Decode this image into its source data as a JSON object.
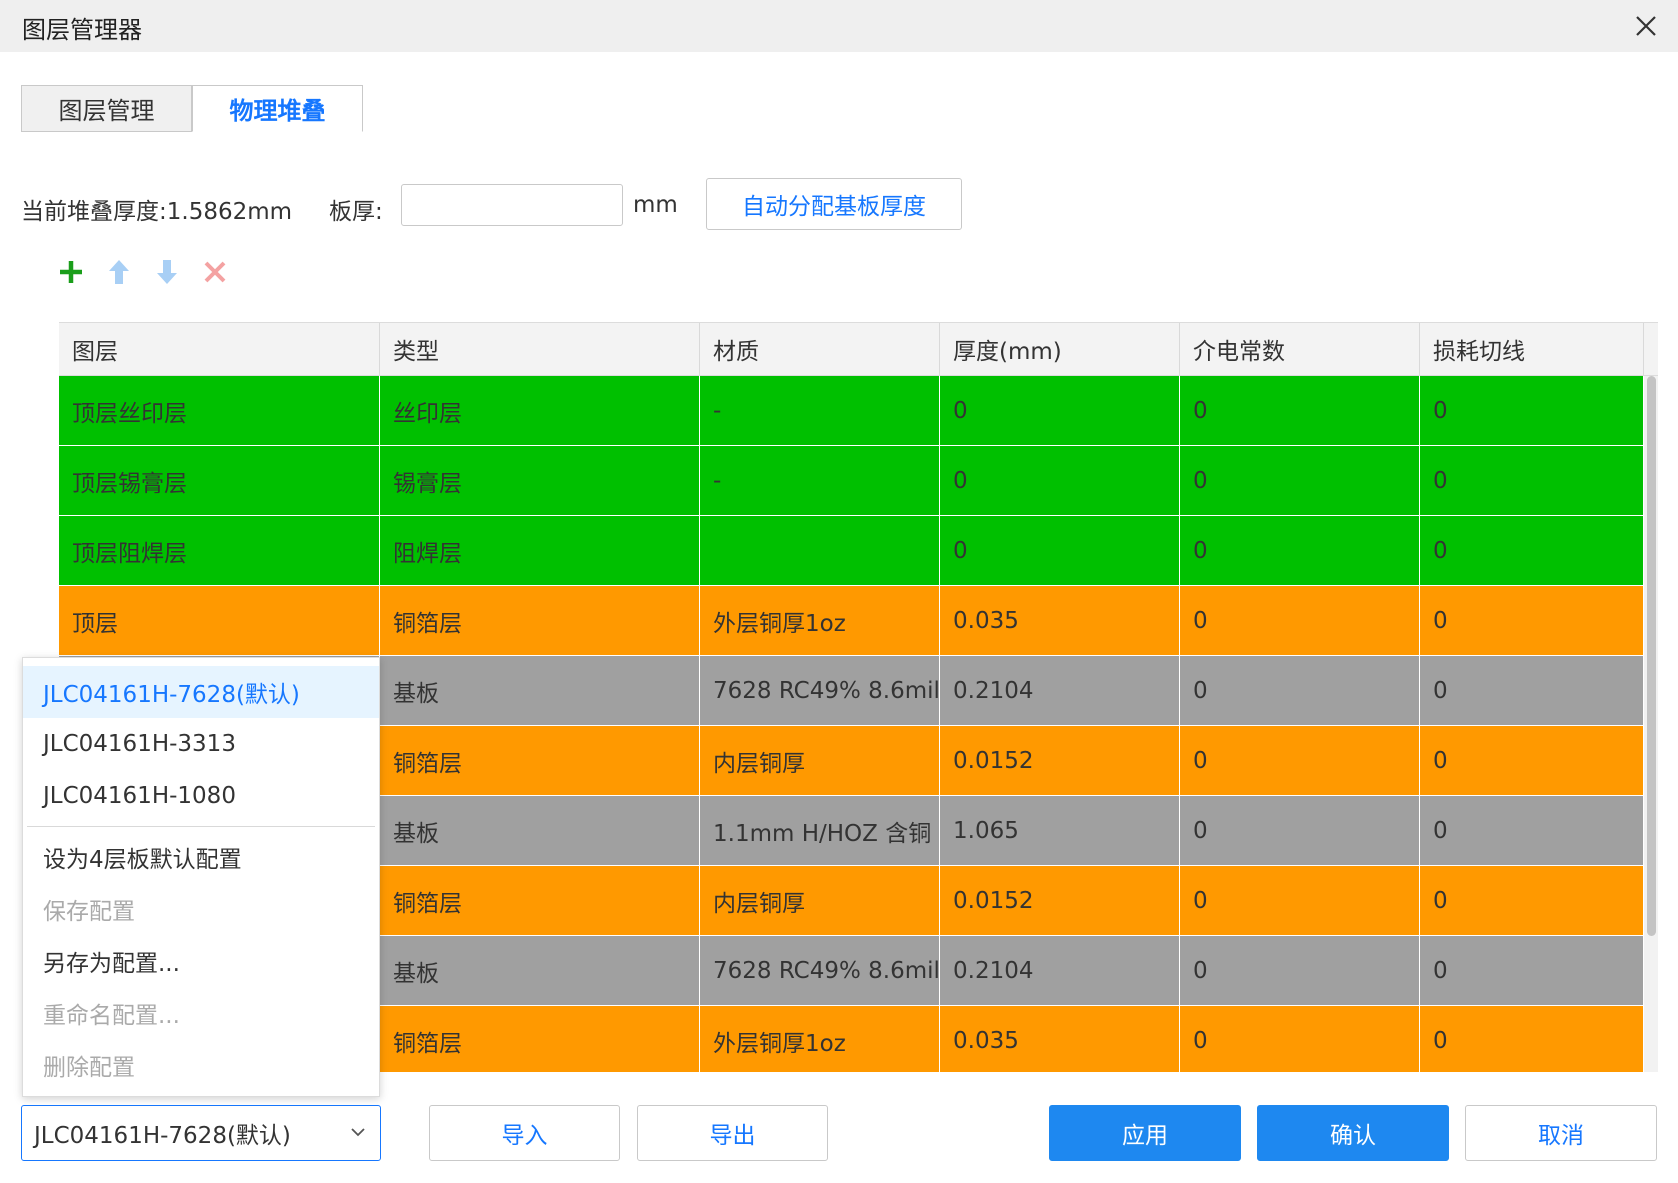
{
  "window": {
    "title": "图层管理器",
    "close_icon": "close-icon"
  },
  "tabs": [
    {
      "label": "图层管理",
      "active": false
    },
    {
      "label": "物理堆叠",
      "active": true
    }
  ],
  "stack_info": {
    "current_thickness_label": "当前堆叠厚度:1.5862mm",
    "board_thickness_label": "板厚:",
    "board_thickness_value": "",
    "unit": "mm",
    "auto_assign_button": "自动分配基板厚度"
  },
  "toolbar": {
    "add_icon": "plus-icon",
    "up_icon": "arrow-up-icon",
    "down_icon": "arrow-down-icon",
    "delete_icon": "delete-x-icon",
    "colors": {
      "add": "#1a9e1a",
      "up": "#a8cff5",
      "down": "#a8cff5",
      "delete": "#f4a2a2"
    }
  },
  "table": {
    "headers": [
      "图层",
      "类型",
      "材质",
      "厚度(mm)",
      "介电常数",
      "损耗切线"
    ],
    "colors": {
      "green": "#00c000",
      "orange": "#ff9900",
      "gray": "#a0a0a0"
    },
    "rows": [
      {
        "layer": "顶层丝印层",
        "type": "丝印层",
        "material": "-",
        "thickness": "0",
        "dk": "0",
        "df": "0",
        "color": "green"
      },
      {
        "layer": "顶层锡膏层",
        "type": "锡膏层",
        "material": "-",
        "thickness": "0",
        "dk": "0",
        "df": "0",
        "color": "green"
      },
      {
        "layer": "顶层阻焊层",
        "type": "阻焊层",
        "material": "",
        "thickness": "0",
        "dk": "0",
        "df": "0",
        "color": "green"
      },
      {
        "layer": "顶层",
        "type": "铜箔层",
        "material": "外层铜厚1oz",
        "thickness": "0.035",
        "dk": "0",
        "df": "0",
        "color": "orange"
      },
      {
        "layer": "",
        "type": "基板",
        "material": "7628 RC49% 8.6mil",
        "thickness": "0.2104",
        "dk": "0",
        "df": "0",
        "color": "gray"
      },
      {
        "layer": "",
        "type": "铜箔层",
        "material": "内层铜厚",
        "thickness": "0.0152",
        "dk": "0",
        "df": "0",
        "color": "orange"
      },
      {
        "layer": "",
        "type": "基板",
        "material": "1.1mm H/HOZ 含铜",
        "thickness": "1.065",
        "dk": "0",
        "df": "0",
        "color": "gray"
      },
      {
        "layer": "",
        "type": "铜箔层",
        "material": "内层铜厚",
        "thickness": "0.0152",
        "dk": "0",
        "df": "0",
        "color": "orange"
      },
      {
        "layer": "",
        "type": "基板",
        "material": "7628 RC49% 8.6mil",
        "thickness": "0.2104",
        "dk": "0",
        "df": "0",
        "color": "gray"
      },
      {
        "layer": "",
        "type": "铜箔层",
        "material": "外层铜厚1oz",
        "thickness": "0.035",
        "dk": "0",
        "df": "0",
        "color": "orange"
      }
    ]
  },
  "config_menu": {
    "items": [
      {
        "label": "JLC04161H-7628(默认)",
        "state": "selected"
      },
      {
        "label": "JLC04161H-3313",
        "state": "normal"
      },
      {
        "label": "JLC04161H-1080",
        "state": "normal"
      }
    ],
    "actions": [
      {
        "label": "设为4层板默认配置",
        "state": "normal"
      },
      {
        "label": "保存配置",
        "state": "disabled"
      },
      {
        "label": "另存为配置...",
        "state": "normal"
      },
      {
        "label": "重命名配置...",
        "state": "disabled"
      },
      {
        "label": "删除配置",
        "state": "disabled"
      }
    ]
  },
  "footer": {
    "config_select_value": "JLC04161H-7628(默认)",
    "chevron_icon": "chevron-down-icon",
    "import_button": "导入",
    "export_button": "导出",
    "apply_button": "应用",
    "confirm_button": "确认",
    "cancel_button": "取消"
  }
}
